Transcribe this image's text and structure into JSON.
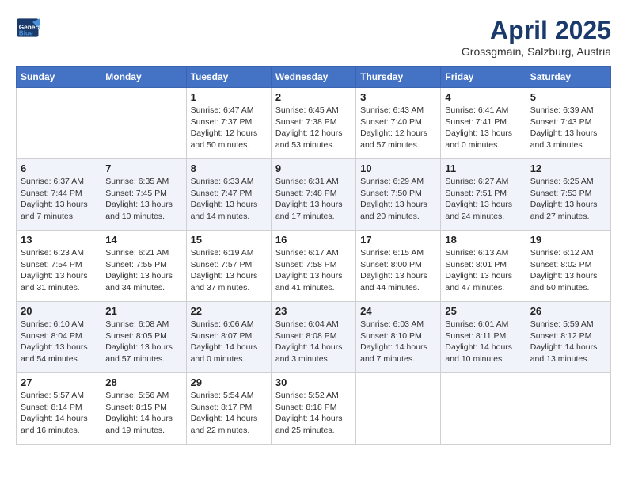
{
  "logo": {
    "line1": "General",
    "line2": "Blue"
  },
  "title": "April 2025",
  "subtitle": "Grossgmain, Salzburg, Austria",
  "days_of_week": [
    "Sunday",
    "Monday",
    "Tuesday",
    "Wednesday",
    "Thursday",
    "Friday",
    "Saturday"
  ],
  "weeks": [
    [
      {
        "day": "",
        "info": ""
      },
      {
        "day": "",
        "info": ""
      },
      {
        "day": "1",
        "sunrise": "6:47 AM",
        "sunset": "7:37 PM",
        "daylight": "12 hours and 50 minutes."
      },
      {
        "day": "2",
        "sunrise": "6:45 AM",
        "sunset": "7:38 PM",
        "daylight": "12 hours and 53 minutes."
      },
      {
        "day": "3",
        "sunrise": "6:43 AM",
        "sunset": "7:40 PM",
        "daylight": "12 hours and 57 minutes."
      },
      {
        "day": "4",
        "sunrise": "6:41 AM",
        "sunset": "7:41 PM",
        "daylight": "13 hours and 0 minutes."
      },
      {
        "day": "5",
        "sunrise": "6:39 AM",
        "sunset": "7:43 PM",
        "daylight": "13 hours and 3 minutes."
      }
    ],
    [
      {
        "day": "6",
        "sunrise": "6:37 AM",
        "sunset": "7:44 PM",
        "daylight": "13 hours and 7 minutes."
      },
      {
        "day": "7",
        "sunrise": "6:35 AM",
        "sunset": "7:45 PM",
        "daylight": "13 hours and 10 minutes."
      },
      {
        "day": "8",
        "sunrise": "6:33 AM",
        "sunset": "7:47 PM",
        "daylight": "13 hours and 14 minutes."
      },
      {
        "day": "9",
        "sunrise": "6:31 AM",
        "sunset": "7:48 PM",
        "daylight": "13 hours and 17 minutes."
      },
      {
        "day": "10",
        "sunrise": "6:29 AM",
        "sunset": "7:50 PM",
        "daylight": "13 hours and 20 minutes."
      },
      {
        "day": "11",
        "sunrise": "6:27 AM",
        "sunset": "7:51 PM",
        "daylight": "13 hours and 24 minutes."
      },
      {
        "day": "12",
        "sunrise": "6:25 AM",
        "sunset": "7:53 PM",
        "daylight": "13 hours and 27 minutes."
      }
    ],
    [
      {
        "day": "13",
        "sunrise": "6:23 AM",
        "sunset": "7:54 PM",
        "daylight": "13 hours and 31 minutes."
      },
      {
        "day": "14",
        "sunrise": "6:21 AM",
        "sunset": "7:55 PM",
        "daylight": "13 hours and 34 minutes."
      },
      {
        "day": "15",
        "sunrise": "6:19 AM",
        "sunset": "7:57 PM",
        "daylight": "13 hours and 37 minutes."
      },
      {
        "day": "16",
        "sunrise": "6:17 AM",
        "sunset": "7:58 PM",
        "daylight": "13 hours and 41 minutes."
      },
      {
        "day": "17",
        "sunrise": "6:15 AM",
        "sunset": "8:00 PM",
        "daylight": "13 hours and 44 minutes."
      },
      {
        "day": "18",
        "sunrise": "6:13 AM",
        "sunset": "8:01 PM",
        "daylight": "13 hours and 47 minutes."
      },
      {
        "day": "19",
        "sunrise": "6:12 AM",
        "sunset": "8:02 PM",
        "daylight": "13 hours and 50 minutes."
      }
    ],
    [
      {
        "day": "20",
        "sunrise": "6:10 AM",
        "sunset": "8:04 PM",
        "daylight": "13 hours and 54 minutes."
      },
      {
        "day": "21",
        "sunrise": "6:08 AM",
        "sunset": "8:05 PM",
        "daylight": "13 hours and 57 minutes."
      },
      {
        "day": "22",
        "sunrise": "6:06 AM",
        "sunset": "8:07 PM",
        "daylight": "14 hours and 0 minutes."
      },
      {
        "day": "23",
        "sunrise": "6:04 AM",
        "sunset": "8:08 PM",
        "daylight": "14 hours and 3 minutes."
      },
      {
        "day": "24",
        "sunrise": "6:03 AM",
        "sunset": "8:10 PM",
        "daylight": "14 hours and 7 minutes."
      },
      {
        "day": "25",
        "sunrise": "6:01 AM",
        "sunset": "8:11 PM",
        "daylight": "14 hours and 10 minutes."
      },
      {
        "day": "26",
        "sunrise": "5:59 AM",
        "sunset": "8:12 PM",
        "daylight": "14 hours and 13 minutes."
      }
    ],
    [
      {
        "day": "27",
        "sunrise": "5:57 AM",
        "sunset": "8:14 PM",
        "daylight": "14 hours and 16 minutes."
      },
      {
        "day": "28",
        "sunrise": "5:56 AM",
        "sunset": "8:15 PM",
        "daylight": "14 hours and 19 minutes."
      },
      {
        "day": "29",
        "sunrise": "5:54 AM",
        "sunset": "8:17 PM",
        "daylight": "14 hours and 22 minutes."
      },
      {
        "day": "30",
        "sunrise": "5:52 AM",
        "sunset": "8:18 PM",
        "daylight": "14 hours and 25 minutes."
      },
      {
        "day": "",
        "info": ""
      },
      {
        "day": "",
        "info": ""
      },
      {
        "day": "",
        "info": ""
      }
    ]
  ]
}
